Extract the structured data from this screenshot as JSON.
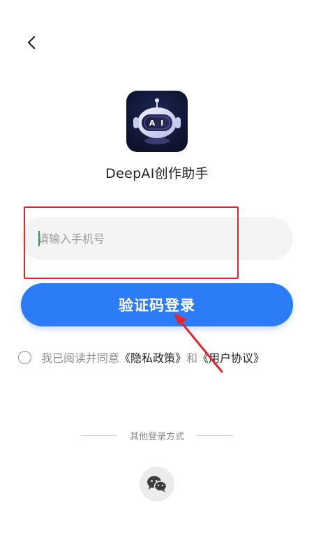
{
  "nav": {
    "back_icon": "chevron-left-icon"
  },
  "app": {
    "name": "DeepAI创作助手",
    "logo_text": "A I",
    "logo_icon": "robot-ai-logo-icon"
  },
  "login": {
    "phone_placeholder": "请输入手机号",
    "phone_value": "",
    "submit_label": "验证码登录"
  },
  "agreement": {
    "prefix": "我已阅读并同意",
    "privacy_link": "《隐私政策》",
    "joiner": "和",
    "terms_link": "《用户协议》",
    "checked": false
  },
  "other_login": {
    "label": "其他登录方式",
    "wechat_icon": "wechat-icon"
  },
  "colors": {
    "primary": "#2b7cf6",
    "annotation": "#e8242a",
    "field_bg": "#f4f4f4"
  }
}
